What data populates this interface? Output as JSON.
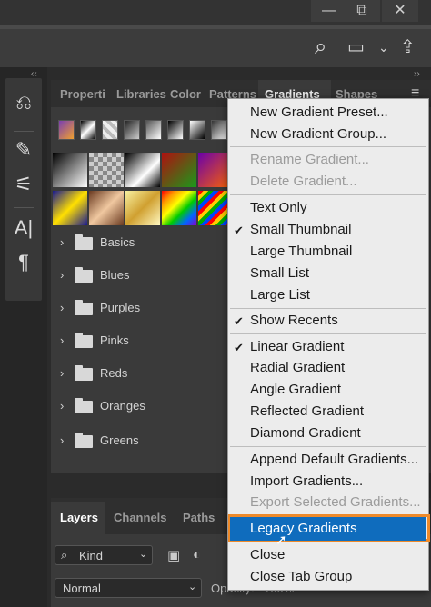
{
  "window_controls": {
    "minimize": "—",
    "restore": "⧉",
    "close": "✕"
  },
  "options_bar": {
    "icons": [
      "search-icon",
      "workspace-icon",
      "chevron-down-icon",
      "share-icon"
    ],
    "search_glyph": "⌕",
    "workspace_glyph": "▭",
    "chevron_glyph": "⌄",
    "share_glyph": "⇪"
  },
  "collapse": {
    "left": "‹‹",
    "right": "››"
  },
  "toolbar": {
    "tools": [
      {
        "name": "history-icon",
        "glyph": "⎌"
      },
      {
        "name": "brush-icon",
        "glyph": "✎"
      },
      {
        "name": "sliders-icon",
        "glyph": "⚟"
      },
      {
        "name": "type-icon",
        "glyph": "A|"
      },
      {
        "name": "paragraph-icon",
        "glyph": "¶"
      }
    ]
  },
  "gradients_panel": {
    "tabs": [
      "Properti",
      "Libraries",
      "Color",
      "Patterns",
      "Gradients",
      "Shapes"
    ],
    "active_tab": "Gradients",
    "menu_glyph": "≡",
    "groups": [
      "Basics",
      "Blues",
      "Purples",
      "Pinks",
      "Reds",
      "Oranges",
      "Greens"
    ],
    "chevron_glyph": "›"
  },
  "layers_panel": {
    "tabs": [
      "Layers",
      "Channels",
      "Paths"
    ],
    "active_tab": "Layers",
    "filter_value": "Kind",
    "blend_mode": "Normal",
    "opacity_label": "Opacity:",
    "opacity_value": "100%"
  },
  "context_menu": {
    "items": [
      {
        "label": "New Gradient Preset...",
        "enabled": true,
        "checked": false
      },
      {
        "label": "New Gradient Group...",
        "enabled": true,
        "checked": false
      },
      {
        "label": "Rename Gradient...",
        "enabled": false,
        "checked": false
      },
      {
        "label": "Delete Gradient...",
        "enabled": false,
        "checked": false
      },
      {
        "label": "Text Only",
        "enabled": true,
        "checked": false
      },
      {
        "label": "Small Thumbnail",
        "enabled": true,
        "checked": true
      },
      {
        "label": "Large Thumbnail",
        "enabled": true,
        "checked": false
      },
      {
        "label": "Small List",
        "enabled": true,
        "checked": false
      },
      {
        "label": "Large List",
        "enabled": true,
        "checked": false
      },
      {
        "label": "Show Recents",
        "enabled": true,
        "checked": true
      },
      {
        "label": "Linear Gradient",
        "enabled": true,
        "checked": true
      },
      {
        "label": "Radial Gradient",
        "enabled": true,
        "checked": false
      },
      {
        "label": "Angle Gradient",
        "enabled": true,
        "checked": false
      },
      {
        "label": "Reflected Gradient",
        "enabled": true,
        "checked": false
      },
      {
        "label": "Diamond Gradient",
        "enabled": true,
        "checked": false
      },
      {
        "label": "Append Default Gradients...",
        "enabled": true,
        "checked": false
      },
      {
        "label": "Import Gradients...",
        "enabled": true,
        "checked": false
      },
      {
        "label": "Export Selected Gradients...",
        "enabled": false,
        "checked": false
      },
      {
        "label": "Legacy Gradients",
        "enabled": true,
        "checked": false,
        "highlighted": true
      },
      {
        "label": "Close",
        "enabled": true,
        "checked": false
      },
      {
        "label": "Close Tab Group",
        "enabled": true,
        "checked": false
      }
    ],
    "check_glyph": "✔",
    "highlight_color": "#0f6cbd",
    "outline_color": "#ee8a2a"
  }
}
